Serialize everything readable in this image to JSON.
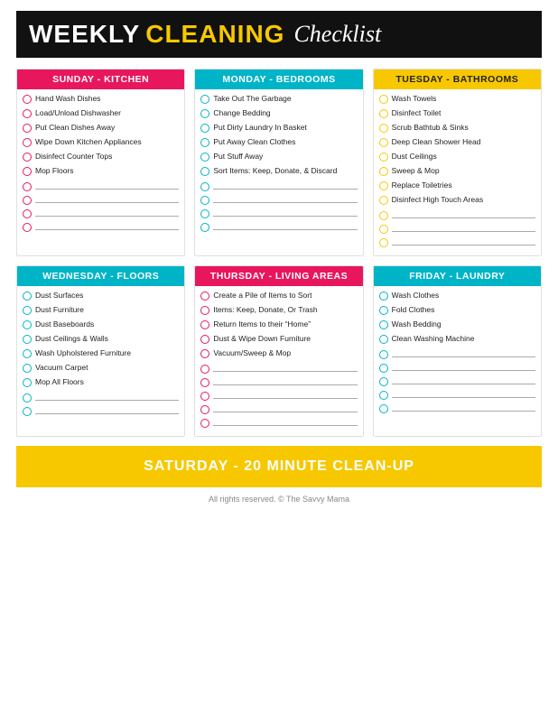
{
  "header": {
    "weekly": "WEEKLY",
    "cleaning": "CLEANING",
    "checklist": "Checklist"
  },
  "sections": [
    {
      "id": "sunday",
      "title": "Sunday - Kitchen",
      "color": "pink",
      "circleColor": "circle-pink",
      "items": [
        "Hand Wash Dishes",
        "Load/Unload Dishwasher",
        "Put Clean Dishes Away",
        "Wipe Down Kitchen Appliances",
        "Disinfect Counter Tops",
        "Mop Floors"
      ],
      "blanks": 4
    },
    {
      "id": "monday",
      "title": "Monday - Bedrooms",
      "color": "teal",
      "circleColor": "circle-teal",
      "items": [
        "Take Out The Garbage",
        "Change Bedding",
        "Put Dirty Laundry In Basket",
        "Put Away Clean Clothes",
        "Put Stuff Away",
        "Sort Items: Keep, Donate, & Discard"
      ],
      "blanks": 4
    },
    {
      "id": "tuesday",
      "title": "Tuesday - Bathrooms",
      "color": "gold",
      "circleColor": "circle-gold",
      "items": [
        "Wash Towels",
        "Disinfect Toilet",
        "Scrub Bathtub & Sinks",
        "Deep Clean Shower Head",
        "Dust Ceilings",
        "Sweep & Mop",
        "Replace Toiletries",
        "Disinfect High Touch Areas"
      ],
      "blanks": 3
    },
    {
      "id": "wednesday",
      "title": "Wednesday - Floors",
      "color": "teal",
      "circleColor": "circle-teal",
      "items": [
        "Dust Surfaces",
        "Dust Furniture",
        "Dust Baseboards",
        "Dust Ceilings & Walls",
        "Wash Upholstered Furniture",
        "Vacuum Carpet",
        "Mop All Floors"
      ],
      "blanks": 2
    },
    {
      "id": "thursday",
      "title": "Thursday - Living Areas",
      "color": "magenta",
      "circleColor": "circle-pink",
      "items": [
        "Create a Pile of Items to Sort",
        "Items: Keep, Donate, Or Trash",
        "Return Items to their “Home”",
        "Dust & Wipe Down Furniture",
        "Vacuum/Sweep & Mop"
      ],
      "blanks": 5
    },
    {
      "id": "friday",
      "title": "Friday - Laundry",
      "color": "cyan",
      "circleColor": "circle-teal",
      "items": [
        "Wash Clothes",
        "Fold Clothes",
        "Wash Bedding",
        "Clean Washing Machine"
      ],
      "blanks": 5
    }
  ],
  "saturday": {
    "title": "Saturday - 20 Minute Clean-Up"
  },
  "footer": {
    "text": "All rights reserved. © The Savvy Mama"
  }
}
